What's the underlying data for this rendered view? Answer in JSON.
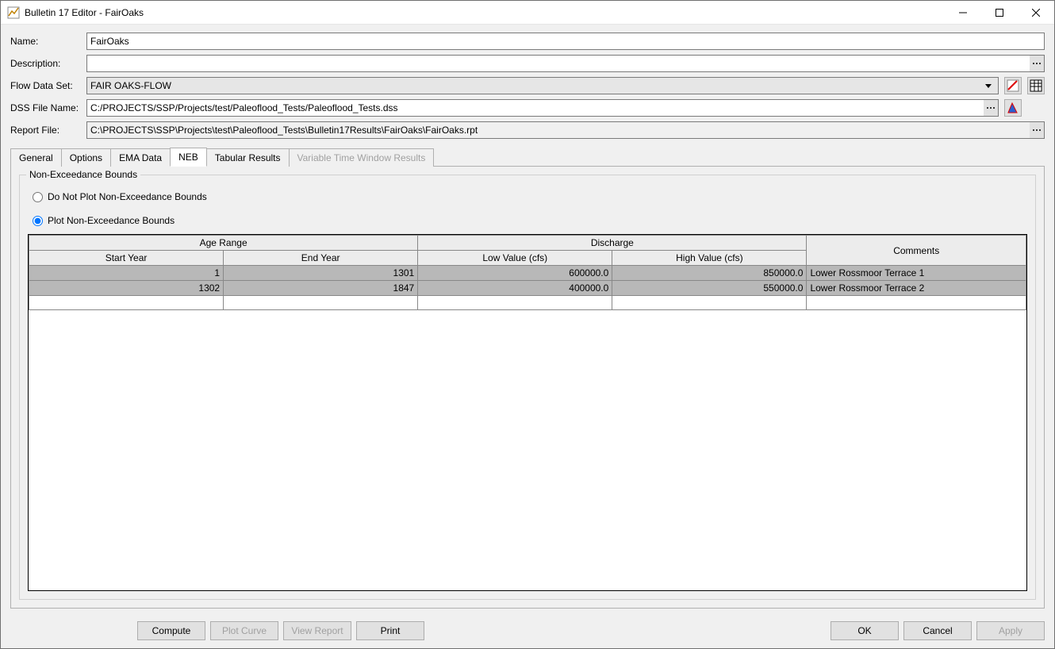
{
  "window": {
    "title": "Bulletin 17 Editor - FairOaks"
  },
  "form": {
    "name_label": "Name:",
    "name_value": "FairOaks",
    "desc_label": "Description:",
    "desc_value": "",
    "flow_label": "Flow Data Set:",
    "flow_value": "FAIR OAKS-FLOW",
    "dss_label": "DSS File Name:",
    "dss_value": "C:/PROJECTS/SSP/Projects/test/Paleoflood_Tests/Paleoflood_Tests.dss",
    "report_label": "Report File:",
    "report_value": "C:\\PROJECTS\\SSP\\Projects\\test\\Paleoflood_Tests\\Bulletin17Results\\FairOaks\\FairOaks.rpt"
  },
  "tabs": {
    "general": "General",
    "options": "Options",
    "ema": "EMA Data",
    "neb": "NEB",
    "tabular": "Tabular Results",
    "vtw": "Variable Time Window Results"
  },
  "neb": {
    "group_title": "Non-Exceedance Bounds",
    "radio_do_not": "Do Not Plot Non-Exceedance Bounds",
    "radio_plot": "Plot Non-Exceedance Bounds",
    "headers": {
      "age_range": "Age Range",
      "discharge": "Discharge",
      "comments": "Comments",
      "start_year": "Start Year",
      "end_year": "End Year",
      "low_value": "Low Value (cfs)",
      "high_value": "High Value (cfs)"
    },
    "rows": [
      {
        "start": "1",
        "end": "1301",
        "low": "600000.0",
        "high": "850000.0",
        "comment": "Lower Rossmoor Terrace 1"
      },
      {
        "start": "1302",
        "end": "1847",
        "low": "400000.0",
        "high": "550000.0",
        "comment": "Lower Rossmoor Terrace 2"
      }
    ]
  },
  "buttons": {
    "compute": "Compute",
    "plot_curve": "Plot Curve",
    "view_report": "View Report",
    "print": "Print",
    "ok": "OK",
    "cancel": "Cancel",
    "apply": "Apply"
  }
}
